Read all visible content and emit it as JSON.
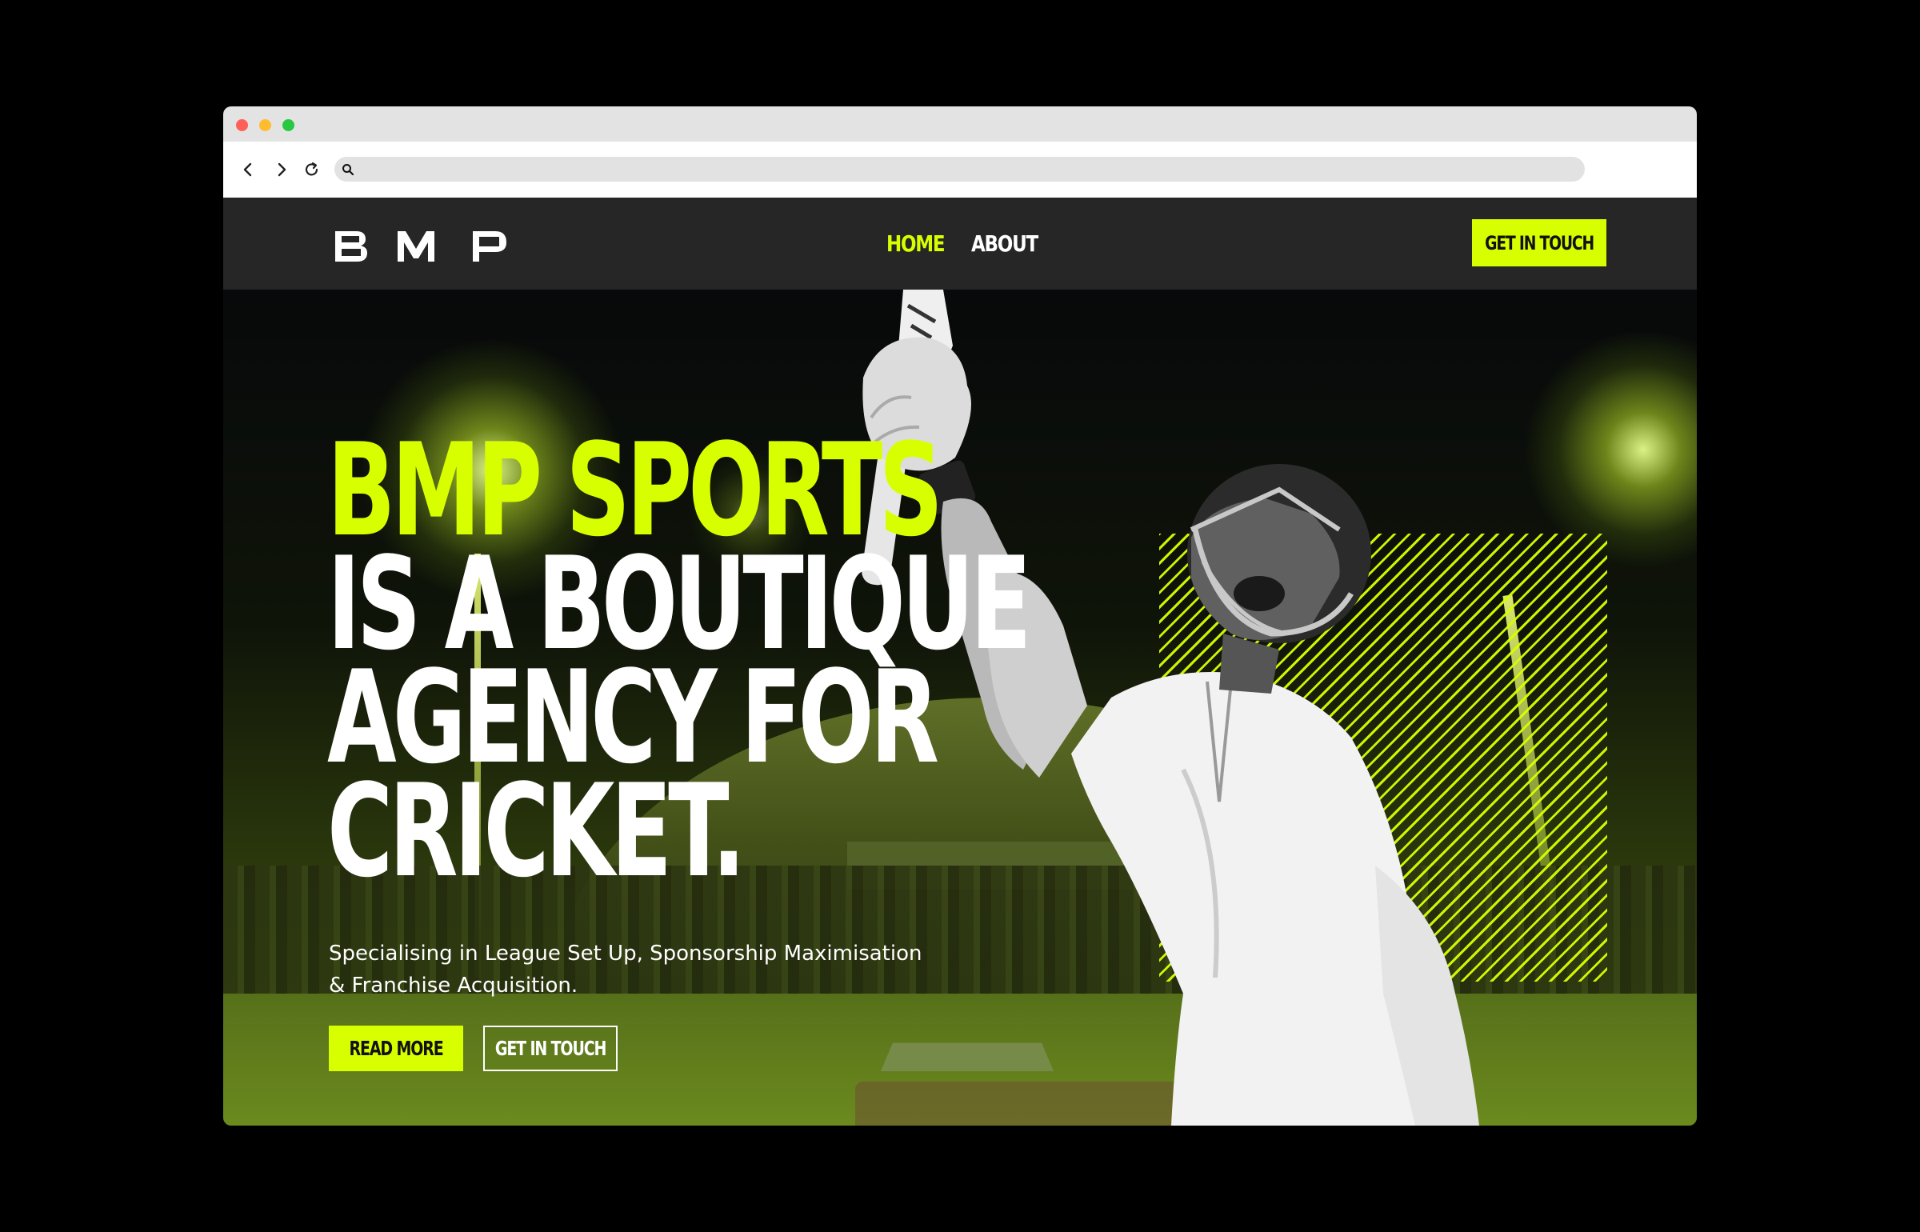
{
  "browser": {
    "address": "",
    "icons": [
      "back-arrow-icon",
      "forward-arrow-icon",
      "reload-icon",
      "search-icon"
    ]
  },
  "site": {
    "logo_text": "BMP",
    "nav": [
      {
        "label": "HOME",
        "active": true
      },
      {
        "label": "ABOUT",
        "active": false
      }
    ],
    "header_cta": "GET IN TOUCH"
  },
  "hero": {
    "headline": [
      "BMP SPORTS",
      "IS A BOUTIQUE",
      "AGENCY FOR",
      "CRICKET."
    ],
    "subtext_line1": "Specialising in League Set Up, Sponsorship Maximisation",
    "subtext_line2": "& Franchise Acquisition.",
    "primary_button": "READ MORE",
    "secondary_button": "GET IN TOUCH"
  },
  "colors": {
    "accent": "#d8ff00",
    "header_bg": "#262626",
    "text": "#ffffff"
  }
}
